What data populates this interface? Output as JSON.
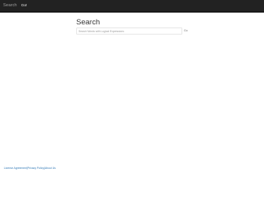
{
  "navbar": {
    "brand": "Search",
    "link": "Go!"
  },
  "main": {
    "title": "Search",
    "search": {
      "placeholder": "Search Words with Logical Expressions",
      "value": ""
    },
    "go_label": "Go"
  },
  "footer": {
    "links": [
      "License Agreement",
      "Privacy Policy",
      "About Us"
    ],
    "separator": "|"
  },
  "colors": {
    "navbar_bg": "#222222",
    "link": "#337ab7",
    "title": "#333333"
  }
}
